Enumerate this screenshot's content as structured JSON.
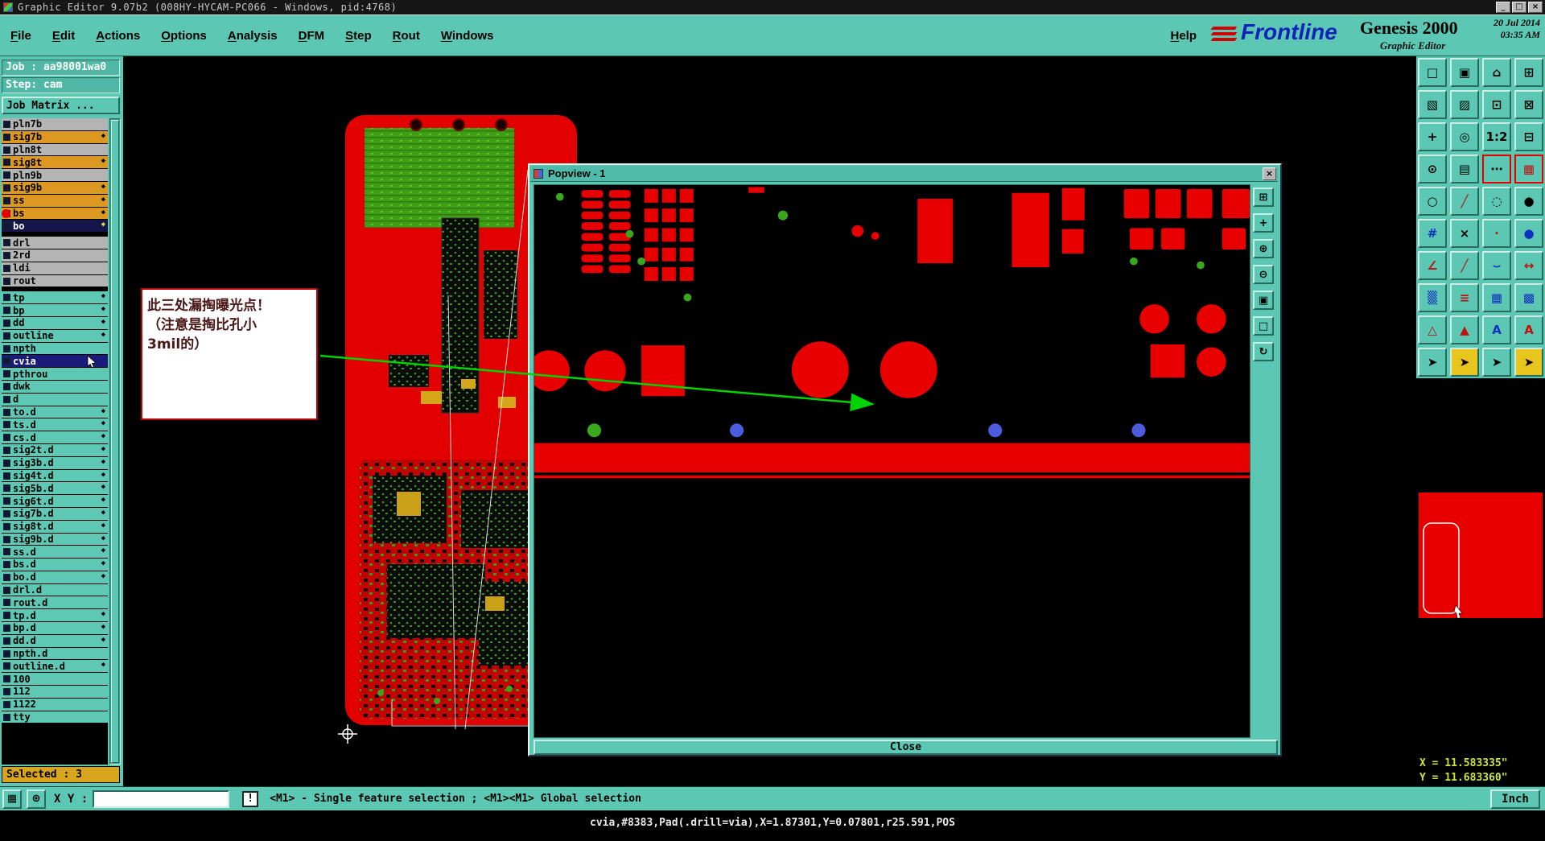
{
  "colors": {
    "teal": "#5cc7b3",
    "board_red": "#e80000",
    "arrow_green": "#00d400",
    "layer_orange": "#dc9820",
    "coord_text": "#cde23c",
    "selection_blue": "#4b5cdc",
    "selected_bar": "#d8a51c"
  },
  "titlebar": {
    "title": "Graphic Editor 9.07b2 (008HY-HYCAM-PC066 - Windows, pid:4768)",
    "buttons": [
      {
        "name": "minimize-button",
        "glyph": "_"
      },
      {
        "name": "maximize-button",
        "glyph": "□"
      },
      {
        "name": "close-button",
        "glyph": "×"
      }
    ]
  },
  "menu": {
    "items": [
      "File",
      "Edit",
      "Actions",
      "Options",
      "Analysis",
      "DFM",
      "Step",
      "Rout",
      "Windows"
    ],
    "help": "Help"
  },
  "brand": {
    "logo": "Frontline",
    "product": "Genesis 2000",
    "date": "20 Jul 2014",
    "time": "03:35 AM",
    "subtitle": "Graphic Editor"
  },
  "job_panel": {
    "job": "Job : aa98001wa0",
    "step": "Step: cam",
    "matrix_button": "Job Matrix ..."
  },
  "layers": {
    "selected_label": "Selected : 3",
    "items": [
      {
        "label": "pln7b",
        "cls": "t-gray"
      },
      {
        "label": "sig7b",
        "cls": "t-orange has-dia"
      },
      {
        "label": "pln8t",
        "cls": "t-gray"
      },
      {
        "label": "sig8t",
        "cls": "t-orange has-dia"
      },
      {
        "label": "pln9b",
        "cls": "t-gray"
      },
      {
        "label": "sig9b",
        "cls": "t-orange has-dia"
      },
      {
        "label": "ss",
        "cls": "t-orange has-dia"
      },
      {
        "label": "bs",
        "cls": "t-orange has-dia has-dot"
      },
      {
        "label": "bo",
        "cls": "t-dark has-dia"
      },
      {
        "label": "drl",
        "cls": "t-gray gap"
      },
      {
        "label": "2rd",
        "cls": "t-gray"
      },
      {
        "label": "ldi",
        "cls": "t-gray"
      },
      {
        "label": "rout",
        "cls": "t-gray"
      },
      {
        "label": "tp",
        "cls": "t-teal has-dia gap"
      },
      {
        "label": "bp",
        "cls": "t-teal has-dia"
      },
      {
        "label": "dd",
        "cls": "t-teal has-dia"
      },
      {
        "label": "outline",
        "cls": "t-teal has-dia"
      },
      {
        "label": "npth",
        "cls": "t-teal"
      },
      {
        "label": "cvia",
        "cls": "t-sel has-cursor"
      },
      {
        "label": "pthrou",
        "cls": "t-teal"
      },
      {
        "label": "dwk",
        "cls": "t-teal"
      },
      {
        "label": "d",
        "cls": "t-teal"
      },
      {
        "label": "to.d",
        "cls": "t-teal has-dia"
      },
      {
        "label": "ts.d",
        "cls": "t-teal has-dia"
      },
      {
        "label": "cs.d",
        "cls": "t-teal has-dia"
      },
      {
        "label": "sig2t.d",
        "cls": "t-teal has-dia"
      },
      {
        "label": "sig3b.d",
        "cls": "t-teal has-dia"
      },
      {
        "label": "sig4t.d",
        "cls": "t-teal has-dia"
      },
      {
        "label": "sig5b.d",
        "cls": "t-teal has-dia"
      },
      {
        "label": "sig6t.d",
        "cls": "t-teal has-dia"
      },
      {
        "label": "sig7b.d",
        "cls": "t-teal has-dia"
      },
      {
        "label": "sig8t.d",
        "cls": "t-teal has-dia"
      },
      {
        "label": "sig9b.d",
        "cls": "t-teal has-dia"
      },
      {
        "label": "ss.d",
        "cls": "t-teal has-dia"
      },
      {
        "label": "bs.d",
        "cls": "t-teal has-dia"
      },
      {
        "label": "bo.d",
        "cls": "t-teal has-dia"
      },
      {
        "label": "drl.d",
        "cls": "t-teal"
      },
      {
        "label": "rout.d",
        "cls": "t-teal"
      },
      {
        "label": "tp.d",
        "cls": "t-teal has-dia"
      },
      {
        "label": "bp.d",
        "cls": "t-teal has-dia"
      },
      {
        "label": "dd.d",
        "cls": "t-teal has-dia"
      },
      {
        "label": "npth.d",
        "cls": "t-teal"
      },
      {
        "label": "outline.d",
        "cls": "t-teal has-dia"
      },
      {
        "label": "100",
        "cls": "t-teal"
      },
      {
        "label": "112",
        "cls": "t-teal"
      },
      {
        "label": "1122",
        "cls": "t-teal"
      },
      {
        "label": "tty",
        "cls": "t-teal"
      }
    ]
  },
  "toolbar": {
    "icons": [
      {
        "name": "select-window-icon",
        "glyph": "□"
      },
      {
        "name": "screen-view-icon",
        "glyph": "▣"
      },
      {
        "name": "home-view-icon",
        "glyph": "⌂"
      },
      {
        "name": "tile-windows-icon",
        "glyph": "⊞"
      },
      {
        "name": "corner-zoom-icon",
        "glyph": "▧"
      },
      {
        "name": "corner-zoom-2-icon",
        "glyph": "▨"
      },
      {
        "name": "zoom-box-icon",
        "glyph": "⊡"
      },
      {
        "name": "zoom-out-box-icon",
        "glyph": "⊠"
      },
      {
        "name": "pan-view-icon",
        "glyph": "+"
      },
      {
        "name": "target-view-icon",
        "glyph": "◎"
      },
      {
        "name": "zoom-1-2-icon",
        "glyph": "1:2"
      },
      {
        "name": "collapse-view-icon",
        "glyph": "⊟"
      },
      {
        "name": "clock-icon",
        "glyph": "⊙"
      },
      {
        "name": "table-icon",
        "glyph": "▤"
      },
      {
        "name": "dots-icon",
        "glyph": "⋯",
        "cls": "active"
      },
      {
        "name": "grid-red-icon",
        "glyph": "▦",
        "color": "#c01010",
        "cls": "active"
      },
      {
        "name": "circle-tool-icon",
        "glyph": "○"
      },
      {
        "name": "slash-red-icon",
        "glyph": "╱",
        "color": "#c01010"
      },
      {
        "name": "dashed-circle-icon",
        "glyph": "◌"
      },
      {
        "name": "filled-circle-icon",
        "glyph": "●"
      },
      {
        "name": "pattern-blue-icon",
        "glyph": "#",
        "color": "#1030c0"
      },
      {
        "name": "delete-x-icon",
        "glyph": "×"
      },
      {
        "name": "small-dot-red-icon",
        "glyph": "·",
        "color": "#c01010"
      },
      {
        "name": "blue-dot-icon",
        "glyph": "●",
        "color": "#1030c0"
      },
      {
        "name": "angle-red-icon",
        "glyph": "∠",
        "color": "#c01010"
      },
      {
        "name": "line-red-icon",
        "glyph": "╱",
        "color": "#c01010"
      },
      {
        "name": "arc-blue-icon",
        "glyph": "⌣",
        "color": "#1030c0"
      },
      {
        "name": "flip-red-icon",
        "glyph": "↔",
        "color": "#c01010"
      },
      {
        "name": "halftone-blue-icon",
        "glyph": "▒",
        "color": "#1030c0"
      },
      {
        "name": "lines-red-icon",
        "glyph": "≡",
        "color": "#c01010"
      },
      {
        "name": "grid-blue-icon",
        "glyph": "▦",
        "color": "#1030c0"
      },
      {
        "name": "mesh-blue-icon",
        "glyph": "▩",
        "color": "#1030c0"
      },
      {
        "name": "triangle-open-red-icon",
        "glyph": "△",
        "color": "#c01010"
      },
      {
        "name": "triangle-red-icon",
        "glyph": "▲",
        "color": "#c01010"
      },
      {
        "name": "text-blue-icon",
        "glyph": "A",
        "color": "#1030c0"
      },
      {
        "name": "text-red-icon",
        "glyph": "A",
        "color": "#c01010"
      },
      {
        "name": "select-arrow-icon",
        "glyph": "➤"
      },
      {
        "name": "select-arrow-add-icon",
        "glyph": "➤",
        "bg": "#e8c61e"
      },
      {
        "name": "select-arrow-2-icon",
        "glyph": "➤"
      },
      {
        "name": "select-arrow-diag-icon",
        "glyph": "➤",
        "bg": "#e8c61e"
      }
    ]
  },
  "popup": {
    "title": "Popview - 1",
    "close_x": "×",
    "close_button": "Close",
    "tools": [
      {
        "name": "clone-view-icon",
        "glyph": "⊞"
      },
      {
        "name": "pan-icon",
        "glyph": "+"
      },
      {
        "name": "zoom-in-icon",
        "glyph": "⊕"
      },
      {
        "name": "zoom-out-icon",
        "glyph": "⊖"
      },
      {
        "name": "fit-view-icon",
        "glyph": "▣"
      },
      {
        "name": "window-select-icon",
        "glyph": "□"
      },
      {
        "name": "refresh-icon",
        "glyph": "↻"
      }
    ]
  },
  "annotation": {
    "line1": "此三处漏掏曝光点！",
    "line2": "（注意是掏比孔小",
    "line3": "3mil的）"
  },
  "statusbar": {
    "grid_glyph": "▦",
    "origin_glyph": "⊕",
    "xy_label": "X Y :",
    "xy_value": "",
    "alert_glyph": "!",
    "message": "<M1> - Single feature selection ; <M1><M1> Global selection",
    "unit_button": "Inch"
  },
  "coords": {
    "x": "X = 11.583335\"",
    "y": "Y = 11.683360\""
  },
  "feature_line": "cvia,#8383,Pad(.drill=via),X=1.87301,Y=0.07801,r25.591,POS"
}
